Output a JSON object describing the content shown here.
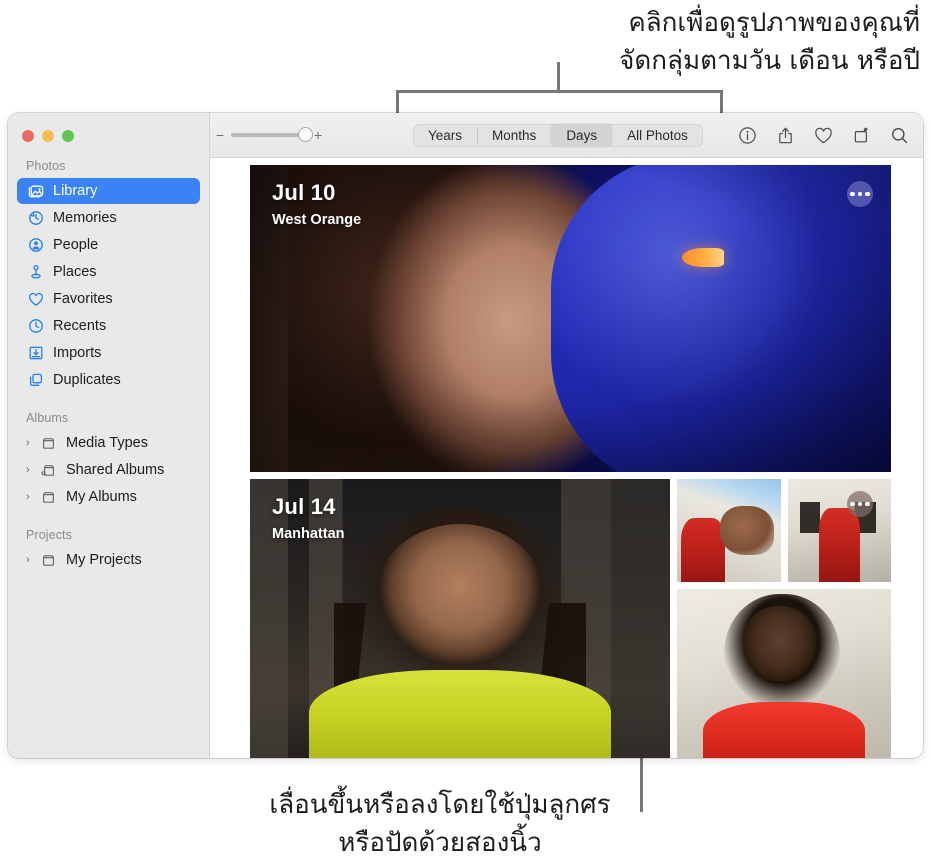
{
  "callouts": {
    "top": "คลิกเพื่อดูรูปภาพของคุณที่\nจัดกลุ่มตามวัน เดือน หรือปี",
    "bottom": "เลื่อนขึ้นหรือลงโดยใช้ปุ่มลูกศร\nหรือปัดด้วยสองนิ้ว"
  },
  "window": {
    "traffic_lights": {
      "close": "close",
      "minimize": "minimize",
      "maximize": "maximize"
    }
  },
  "sidebar": {
    "sections": [
      {
        "header": "Photos",
        "items": [
          {
            "label": "Library",
            "icon": "library-icon",
            "selected": true
          },
          {
            "label": "Memories",
            "icon": "memories-icon",
            "selected": false
          },
          {
            "label": "People",
            "icon": "people-icon",
            "selected": false
          },
          {
            "label": "Places",
            "icon": "places-icon",
            "selected": false
          },
          {
            "label": "Favorites",
            "icon": "heart-icon",
            "selected": false
          },
          {
            "label": "Recents",
            "icon": "clock-icon",
            "selected": false
          },
          {
            "label": "Imports",
            "icon": "import-icon",
            "selected": false
          },
          {
            "label": "Duplicates",
            "icon": "duplicates-icon",
            "selected": false
          }
        ]
      },
      {
        "header": "Albums",
        "items": [
          {
            "label": "Media Types",
            "icon": "folder-icon",
            "disclosure": "›"
          },
          {
            "label": "Shared Albums",
            "icon": "shared-folder-icon",
            "disclosure": "›"
          },
          {
            "label": "My Albums",
            "icon": "folder-icon",
            "disclosure": "›"
          }
        ]
      },
      {
        "header": "Projects",
        "items": [
          {
            "label": "My Projects",
            "icon": "folder-icon",
            "disclosure": "›"
          }
        ]
      }
    ]
  },
  "toolbar": {
    "zoom_slider": {
      "minus": "−",
      "plus": "+",
      "value": 88
    },
    "segments": [
      {
        "label": "Years",
        "active": false
      },
      {
        "label": "Months",
        "active": false
      },
      {
        "label": "Days",
        "active": true
      },
      {
        "label": "All Photos",
        "active": false
      }
    ],
    "icons": [
      {
        "name": "info-icon"
      },
      {
        "name": "share-icon"
      },
      {
        "name": "favorite-heart-icon"
      },
      {
        "name": "rotate-icon"
      },
      {
        "name": "search-icon"
      }
    ]
  },
  "grid": {
    "days": [
      {
        "date": "Jul 10",
        "place": "West Orange",
        "more_label": "more-options"
      },
      {
        "date": "Jul 14",
        "place": "Manhattan",
        "more_label": "more-options"
      }
    ]
  },
  "colors": {
    "accent": "#3b82f6",
    "sidebar_bg": "#e9e9e9",
    "toolbar_bg": "#eaeaea",
    "leader_line": "#77777a"
  }
}
